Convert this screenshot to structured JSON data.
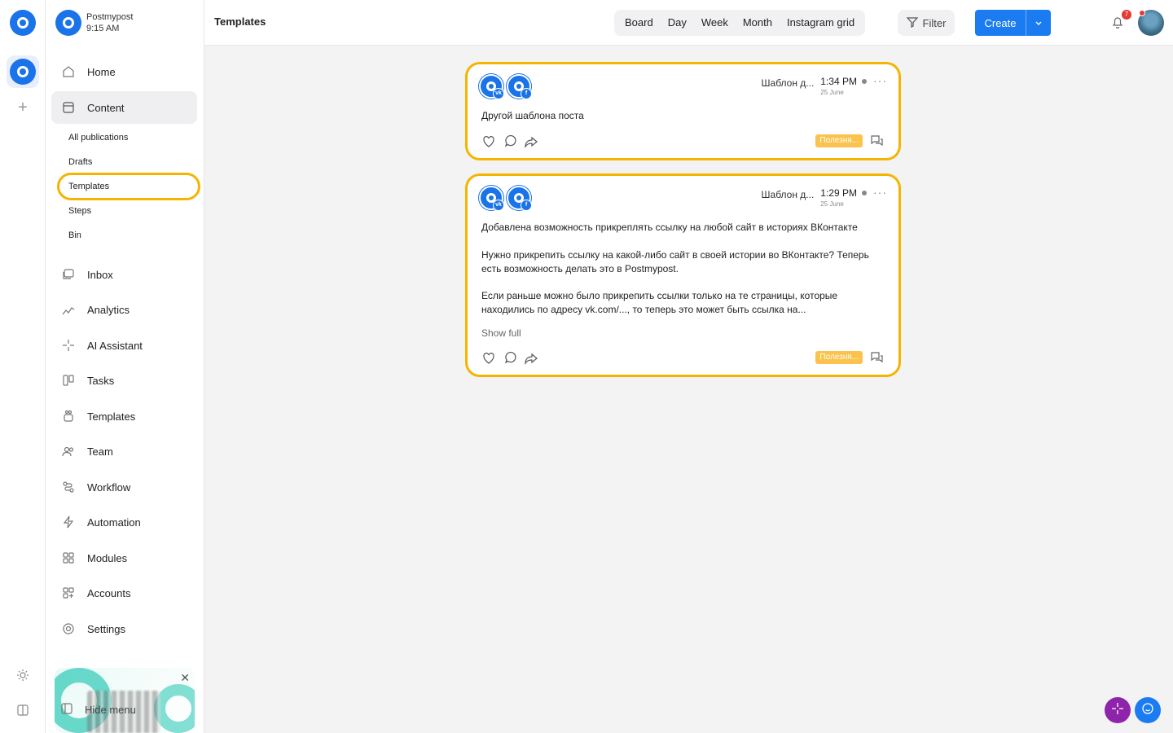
{
  "workspace": {
    "name": "Postmypost",
    "time": "9:15 AM"
  },
  "sidebar": {
    "items": [
      {
        "label": "Home",
        "icon": "home-icon"
      },
      {
        "label": "Content",
        "icon": "content-icon"
      },
      {
        "label": "Inbox",
        "icon": "inbox-icon"
      },
      {
        "label": "Analytics",
        "icon": "analytics-icon"
      },
      {
        "label": "AI Assistant",
        "icon": "sparkle-icon"
      },
      {
        "label": "Tasks",
        "icon": "tasks-icon"
      },
      {
        "label": "Templates",
        "icon": "templates-icon"
      },
      {
        "label": "Team",
        "icon": "team-icon"
      },
      {
        "label": "Workflow",
        "icon": "workflow-icon"
      },
      {
        "label": "Automation",
        "icon": "lightning-icon"
      },
      {
        "label": "Modules",
        "icon": "modules-icon"
      },
      {
        "label": "Accounts",
        "icon": "accounts-icon"
      },
      {
        "label": "Settings",
        "icon": "gear-icon"
      }
    ],
    "content_sub": [
      "All publications",
      "Drafts",
      "Templates",
      "Steps",
      "Bin"
    ],
    "hide_menu": "Hide menu"
  },
  "header": {
    "title": "Templates",
    "views": [
      "Board",
      "Day",
      "Week",
      "Month",
      "Instagram grid"
    ],
    "filter": "Filter",
    "create": "Create",
    "notifications": "7"
  },
  "cards": [
    {
      "template_name": "Шаблон д...",
      "time": "1:34 PM",
      "date": "25 June",
      "networks": [
        "vk",
        "f"
      ],
      "text": "Другой шаблона поста",
      "tag": "Полезня..."
    },
    {
      "template_name": "Шаблон д...",
      "time": "1:29 PM",
      "date": "25 June",
      "networks": [
        "vk",
        "f"
      ],
      "paragraphs": [
        "Добавлена возможность прикреплять ссылку на любой сайт в историях ВКонтакте",
        "Нужно прикрепить ссылку на какой-либо сайт в своей истории во ВКонтакте? Теперь есть возможность делать это в Postmypost.",
        "Если раньше можно было прикрепить ссылки только на те страницы, которые находились по адресу vk.com/..., то теперь это может быть ссылка на..."
      ],
      "show_full": "Show full",
      "tag": "Полезня..."
    }
  ],
  "colors": {
    "accent": "#1a7cf0",
    "highlight": "#f5b400",
    "tag": "#fbc34d",
    "ai_fab": "#8e24aa"
  }
}
